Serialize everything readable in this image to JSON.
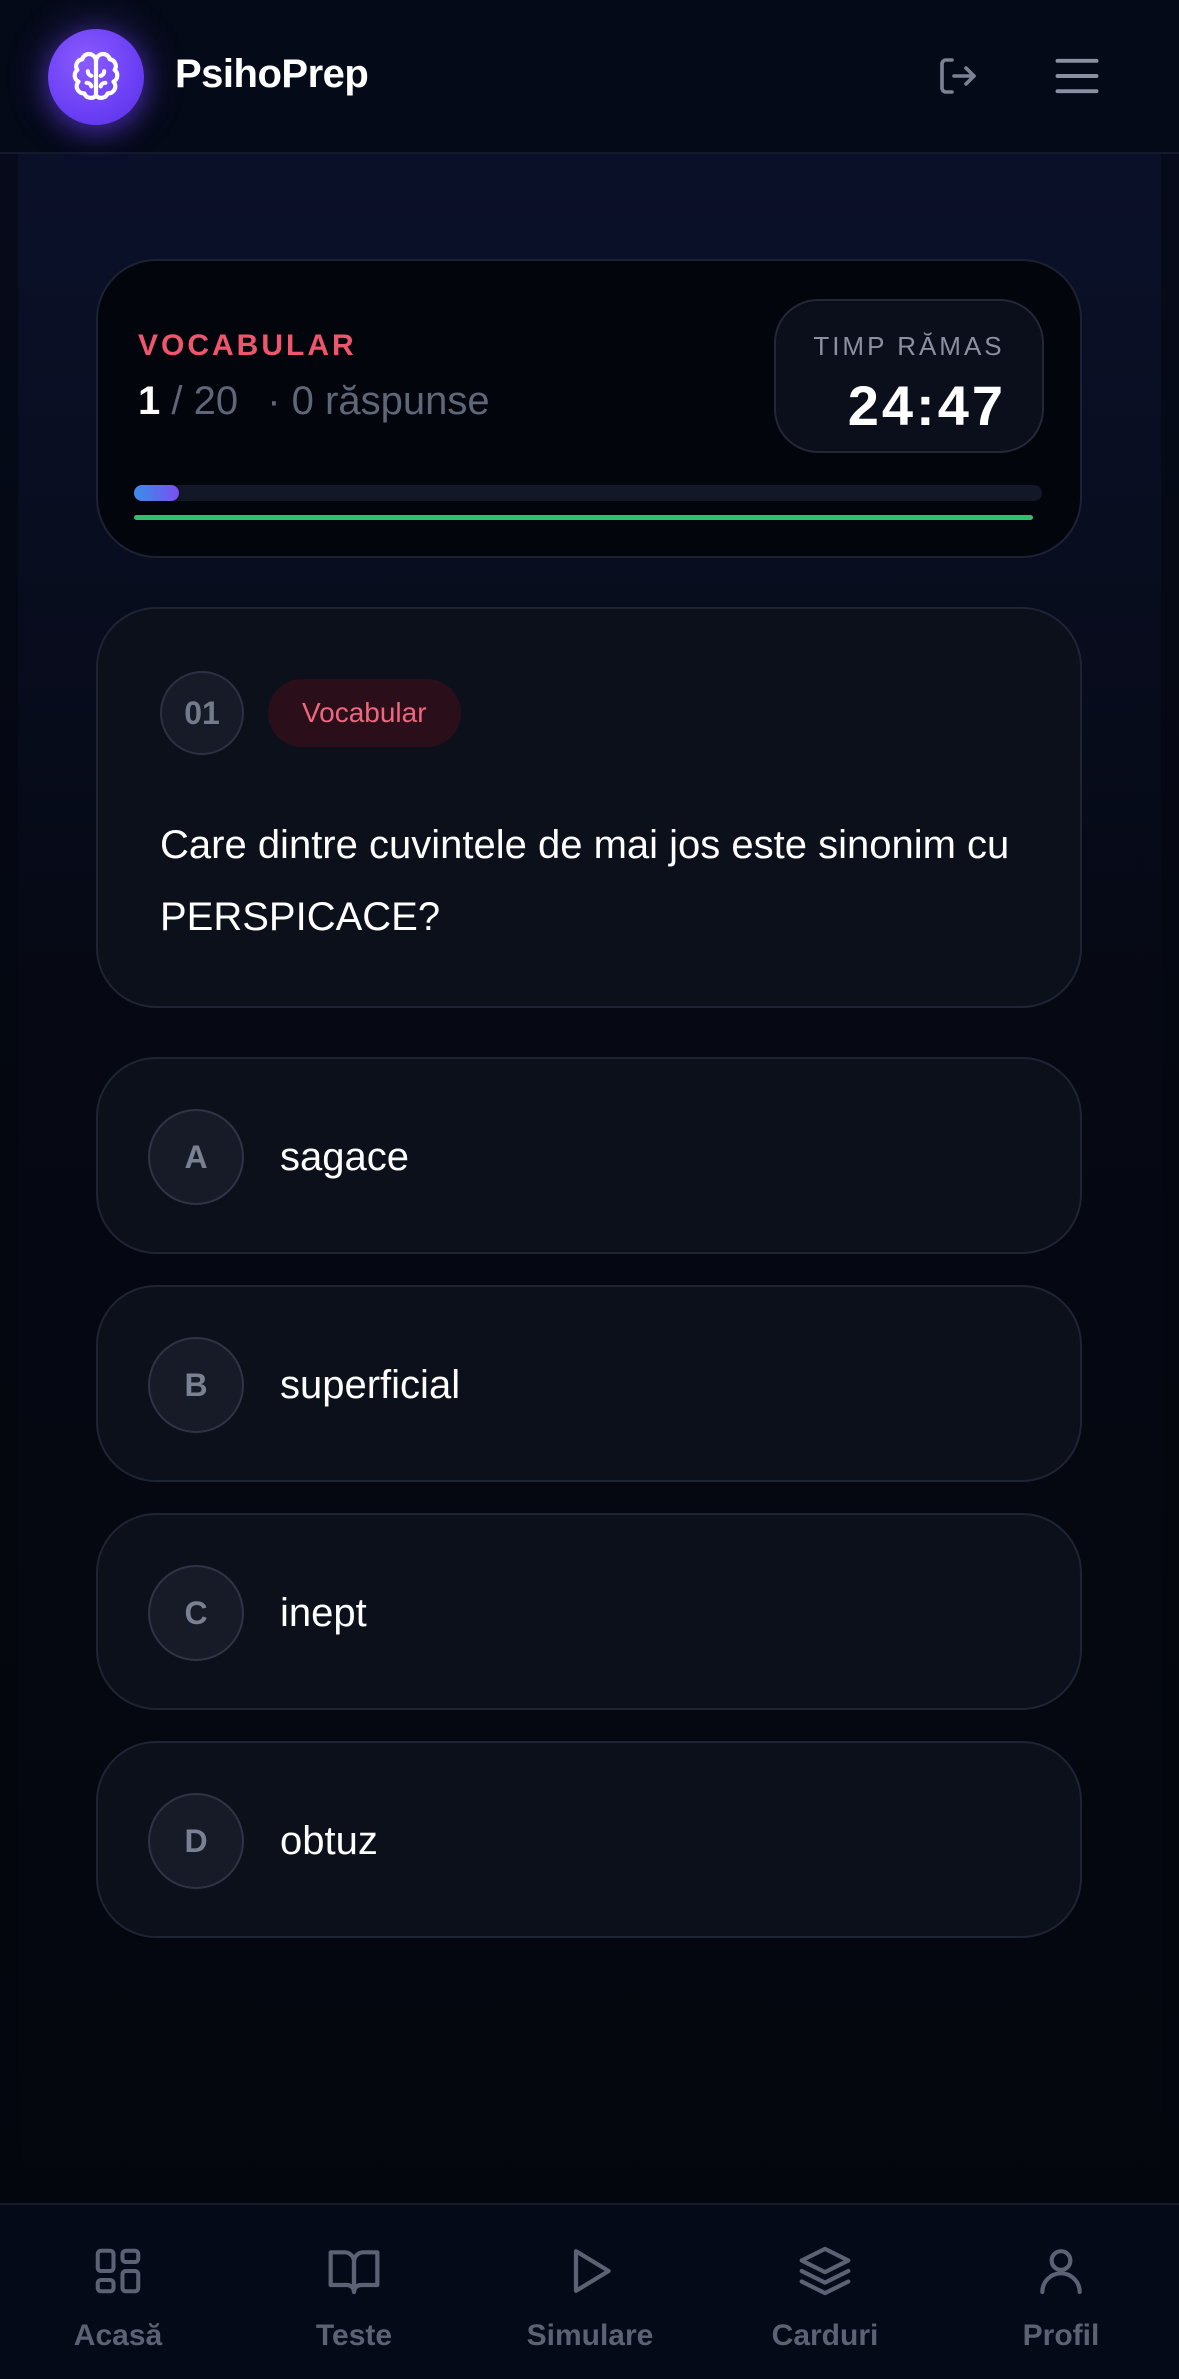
{
  "header": {
    "brand": "PsihoPrep",
    "logo_icon": "brain-icon",
    "logout_icon": "logout-icon",
    "menu_icon": "hamburger-menu-icon"
  },
  "status": {
    "category": "VOCABULAR",
    "current": "1",
    "separator": "/",
    "total": "20",
    "answered": "· 0 răspunse",
    "progress_fraction": 0.05,
    "time_remaining_fraction": 0.99,
    "timer_label": "TIMP RĂMAS",
    "timer_value": "24:47"
  },
  "question": {
    "number": "01",
    "tag": "Vocabular",
    "text": "Care dintre cuvintele de mai jos este sinonim cu PERSPICACE?"
  },
  "options": [
    {
      "letter": "A",
      "text": "sagace"
    },
    {
      "letter": "B",
      "text": "superficial"
    },
    {
      "letter": "C",
      "text": "inept"
    },
    {
      "letter": "D",
      "text": "obtuz"
    }
  ],
  "nav": [
    {
      "label": "Acasă",
      "icon": "grid-icon"
    },
    {
      "label": "Teste",
      "icon": "book-icon"
    },
    {
      "label": "Simulare",
      "icon": "play-icon"
    },
    {
      "label": "Carduri",
      "icon": "layers-icon"
    },
    {
      "label": "Profil",
      "icon": "user-icon"
    }
  ],
  "colors": {
    "accent_purple": "#6b3ff5",
    "category_red": "#f0556e",
    "timer_green": "#2fbf6f",
    "background": "#03060f"
  }
}
